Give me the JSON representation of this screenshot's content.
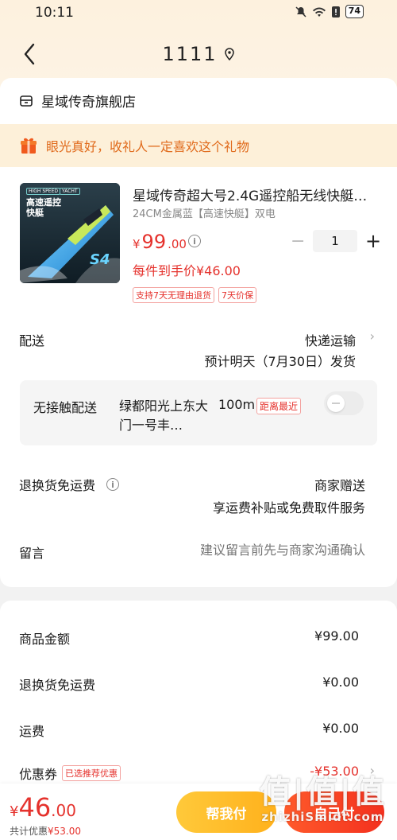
{
  "status_bar": {
    "time": "10:11",
    "battery": "74"
  },
  "header": {
    "address_title": "1111"
  },
  "store": {
    "name": "星域传奇旗舰店"
  },
  "gift_banner": {
    "text": "眼光真好，收礼人一定喜欢这个礼物"
  },
  "product": {
    "title": "星域传奇超大号2.4G遥控船无线快艇…",
    "spec": "24CM金属蓝【高速快艇】双电",
    "price_symbol": "¥",
    "price_int": "99",
    "price_dec": ".00",
    "quantity": "1",
    "unit_price": "每件到手价¥46.00",
    "tags": [
      "支持7天无理由退货",
      "7天价保"
    ],
    "image_text": {
      "badge1": "HIGH SPEED",
      "badge2": "YACHT",
      "title": "高速遥控快艇",
      "label": "S4"
    }
  },
  "shipping": {
    "label": "配送",
    "method": "快递运输",
    "eta": "预计明天（7月30日）发货"
  },
  "contactless": {
    "label": "无接触配送",
    "address": "绿都阳光上东大门一号丰…",
    "distance": "100m",
    "badge": "距离最近",
    "enabled": false
  },
  "return_freight": {
    "label": "退换货免运费",
    "value": "商家赠送",
    "desc": "享运费补贴或免费取件服务"
  },
  "note": {
    "label": "留言",
    "placeholder": "建议留言前先与商家沟通确认"
  },
  "summary": {
    "rows": [
      {
        "label": "商品金额",
        "value": "¥99.00"
      },
      {
        "label": "退换货免运费",
        "value": "¥0.00"
      },
      {
        "label": "运费",
        "value": "¥0.00"
      }
    ],
    "coupon_label": "优惠券",
    "coupon_tag": "已选推荐优惠",
    "coupon_value": "-¥53.00"
  },
  "bottom": {
    "total_symbol": "¥",
    "total_int": "46",
    "total_dec": ".00",
    "saved_prefix": "共计优惠",
    "saved_value": "¥53.00",
    "friend_pay_label": "帮我付",
    "self_pay_label": "自己付"
  },
  "watermark": {
    "logo": "值|值|值",
    "site": "zhizhiSmidt.com"
  },
  "colors": {
    "accent_red": "#e5322d",
    "friend_btn": "#ffb11c",
    "gift_text": "#e06a1b"
  }
}
